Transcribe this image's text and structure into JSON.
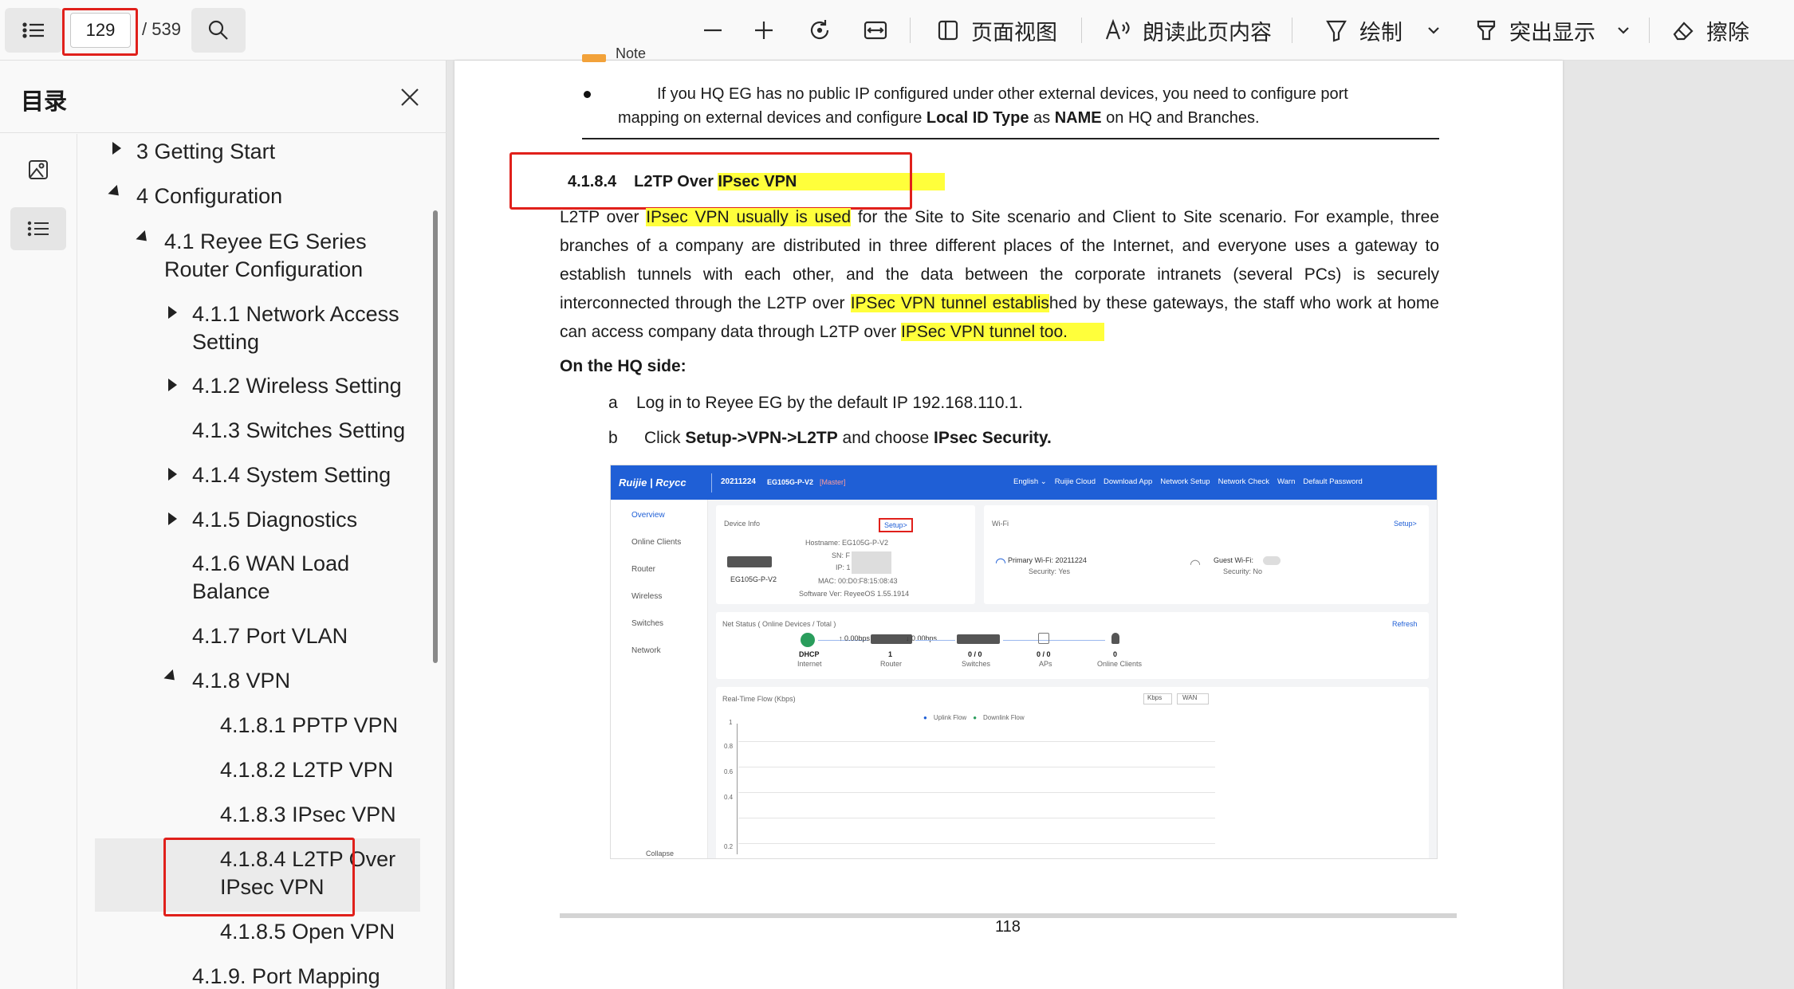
{
  "toolbar": {
    "current_page": "129",
    "total_pages": "/ 539",
    "page_view_label": "页面视图",
    "read_aloud_label": "朗读此页内容",
    "draw_label": "绘制",
    "highlight_label": "突出显示",
    "erase_label": "擦除"
  },
  "sidebar": {
    "title": "目录",
    "items": [
      {
        "label": "3 Getting Start"
      },
      {
        "label": "4 Configuration"
      },
      {
        "label": "4.1 Reyee EG Series",
        "label2": "Router Configuration"
      },
      {
        "label": "4.1.1 Network Access",
        "label2": "Setting"
      },
      {
        "label": "4.1.2 Wireless Setting"
      },
      {
        "label": "4.1.3 Switches Setting"
      },
      {
        "label": "4.1.4 System Setting"
      },
      {
        "label": "4.1.5 Diagnostics"
      },
      {
        "label": "4.1.6 WAN Load",
        "label2": "Balance"
      },
      {
        "label": "4.1.7 Port VLAN"
      },
      {
        "label": "4.1.8 VPN"
      },
      {
        "label": "4.1.8.1 PPTP VPN"
      },
      {
        "label": "4.1.8.2 L2TP VPN"
      },
      {
        "label": "4.1.8.3 IPsec VPN"
      },
      {
        "label": "4.1.8.4 L2TP Over",
        "label2": "IPsec VPN"
      },
      {
        "label": "4.1.8.5 Open VPN"
      },
      {
        "label": "4.1.9. Port Mapping"
      }
    ]
  },
  "doc": {
    "note_partial": "Note",
    "bullet_line1": "If you HQ EG has no public IP configured under other external devices, you need to configure port",
    "bullet_line2a": "mapping on external devices and configure ",
    "bullet_bold1": "Local ID Type",
    "bullet_mid": " as ",
    "bullet_bold2": "NAME",
    "bullet_end": " on HQ and Branches.",
    "heading_num": "4.1.8.4",
    "heading_text1": "L2TP Over ",
    "heading_text2": "IPsec VPN",
    "p1_l1a": "L2TP over ",
    "p1_l1hl": "IPsec VPN usually is used",
    "p1_l1b": " for the Site to Site scenario and Client to Site scenario. For example, three",
    "p1_l2": "branches of a company are distributed in three different places of the Internet, and everyone uses a gateway to",
    "p1_l3": "establish tunnels with each other, and the data between the corporate intranets (several PCs) is securely",
    "p1_l4a": "interconnected through the L2TP over ",
    "p1_l4hl": "IPSec VPN tunnel establis",
    "p1_l4b": "hed by these gateways, the staff who work at home",
    "p1_l5a": "can access company data through L2TP over ",
    "p1_l5hl": "IPSec VPN tunnel too.",
    "hq_side": "On the HQ side:",
    "step_a_marker": "a",
    "step_a": "Log in to Reyee EG by the default IP 192.168.110.1.",
    "step_b_marker": "b",
    "step_b1": "Click ",
    "step_b_bold": "Setup->VPN->L2TP",
    "step_b2": " and choose ",
    "step_b_bold2": "IPsec Security.",
    "page_number": "118"
  },
  "embedded": {
    "brand": "Ruijie | Rcycc",
    "device_id": "20211224",
    "model": "EG105G-P-V2",
    "master": "[Master]",
    "header_links": [
      "English ⌄",
      "Ruijie Cloud",
      "Download App",
      "Network Setup",
      "Network Check",
      "Warn",
      "Default Password"
    ],
    "nav": [
      "Overview",
      "Online Clients",
      "Router",
      "Wireless",
      "Switches",
      "Network"
    ],
    "collapse": "Collapse",
    "device_info": "Device Info",
    "setup": "Setup>",
    "hostname": "Hostname: EG105G-P-V2",
    "sn": "SN: F",
    "ip": "IP: 1",
    "mac": "MAC: 00:D0:F8:15:08:43",
    "sw": "Software Ver: ReyeeOS 1.55.1914",
    "dev_name": "EG105G-P-V2",
    "wifi": "Wi-Fi",
    "wifi_setup": "Setup>",
    "primary_wifi": "Primary Wi-Fi: 20211224",
    "primary_sec": "Security: Yes",
    "guest_wifi": "Guest Wi-Fi:",
    "guest_sec": "Security: No",
    "net_status": "Net Status ( Online Devices / Total )",
    "refresh": "Refresh",
    "dhcp": "DHCP",
    "internet": "Internet",
    "up": "↑ 0.00bps",
    "down": "↓ 0.00bps",
    "router_count": "1",
    "router": "Router",
    "switch_count": "0 / 0",
    "switches": "Switches",
    "ap_count": "0 / 0",
    "aps": "APs",
    "client_count": "0",
    "clients": "Online Clients",
    "flow_title": "Real-Time Flow (Kbps)",
    "kbps": "Kbps",
    "wan": "WAN",
    "uplink": "Uplink Flow",
    "downlink": "Downlink Flow",
    "yticks": [
      "1",
      "0.8",
      "0.6",
      "0.4",
      "0.2"
    ]
  },
  "colors": {
    "highlight": "#ffff3b",
    "annotation_red": "#e0201b",
    "embed_header": "#1f5fd6"
  }
}
